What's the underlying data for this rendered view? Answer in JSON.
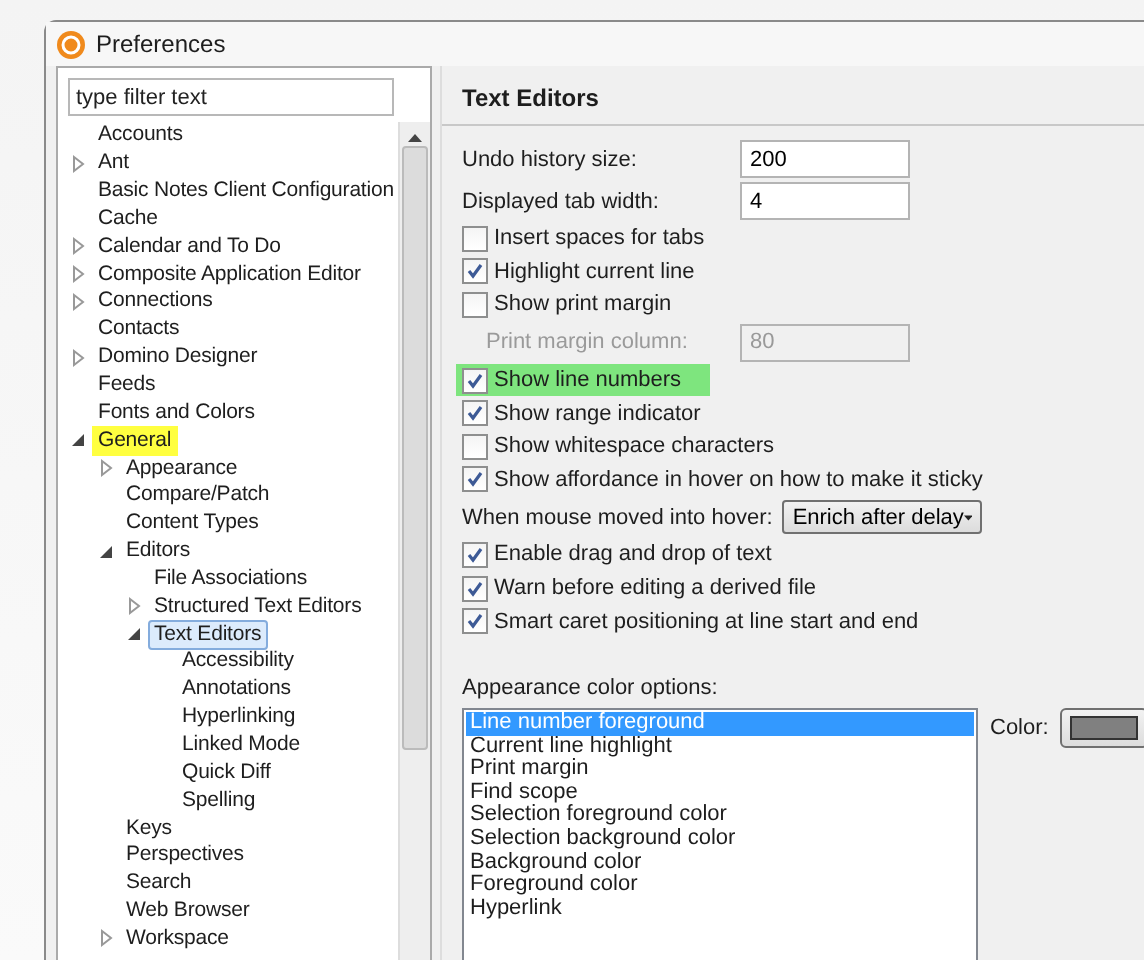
{
  "window": {
    "title": "Preferences"
  },
  "filter": {
    "placeholder": "type filter text"
  },
  "tree": [
    {
      "label": "Accounts",
      "selected": false,
      "highlighted": false
    },
    {
      "label": "Ant",
      "expanded": false,
      "selected": false,
      "highlighted": false
    },
    {
      "label": "Basic Notes Client Configuration",
      "selected": false,
      "highlighted": false
    },
    {
      "label": "Cache",
      "selected": false,
      "highlighted": false
    },
    {
      "label": "Calendar and To Do",
      "expanded": false,
      "selected": false,
      "highlighted": false
    },
    {
      "label": "Composite Application Editor",
      "expanded": false,
      "selected": false,
      "highlighted": false
    },
    {
      "label": "Connections",
      "expanded": false,
      "selected": false,
      "highlighted": false
    },
    {
      "label": "Contacts",
      "selected": false,
      "highlighted": false
    },
    {
      "label": "Domino Designer",
      "expanded": false,
      "selected": false,
      "highlighted": false
    },
    {
      "label": "Feeds",
      "selected": false,
      "highlighted": false
    },
    {
      "label": "Fonts and Colors",
      "selected": false,
      "highlighted": false
    },
    {
      "label": "General",
      "expanded": true,
      "selected": false,
      "highlighted": true,
      "children": [
        {
          "label": "Appearance",
          "expanded": false,
          "selected": false,
          "highlighted": false
        },
        {
          "label": "Compare/Patch",
          "selected": false,
          "highlighted": false
        },
        {
          "label": "Content Types",
          "selected": false,
          "highlighted": false
        },
        {
          "label": "Editors",
          "expanded": true,
          "selected": false,
          "highlighted": false,
          "children": [
            {
              "label": "File Associations",
              "selected": false,
              "highlighted": false
            },
            {
              "label": "Structured Text Editors",
              "expanded": false,
              "selected": false,
              "highlighted": false
            },
            {
              "label": "Text Editors",
              "expanded": true,
              "selected": true,
              "highlighted": false,
              "children": [
                {
                  "label": "Accessibility",
                  "selected": false,
                  "highlighted": false
                },
                {
                  "label": "Annotations",
                  "selected": false,
                  "highlighted": false
                },
                {
                  "label": "Hyperlinking",
                  "selected": false,
                  "highlighted": false
                },
                {
                  "label": "Linked Mode",
                  "selected": false,
                  "highlighted": false
                },
                {
                  "label": "Quick Diff",
                  "selected": false,
                  "highlighted": false
                },
                {
                  "label": "Spelling",
                  "selected": false,
                  "highlighted": false
                }
              ]
            }
          ]
        },
        {
          "label": "Keys",
          "selected": false,
          "highlighted": false
        },
        {
          "label": "Perspectives",
          "selected": false,
          "highlighted": false
        },
        {
          "label": "Search",
          "selected": false,
          "highlighted": false
        },
        {
          "label": "Web Browser",
          "selected": false,
          "highlighted": false
        },
        {
          "label": "Workspace",
          "expanded": false,
          "selected": false,
          "highlighted": false
        }
      ]
    }
  ],
  "page": {
    "title": "Text Editors",
    "settings": [
      {
        "kind": "field",
        "label": "Undo history size:",
        "value": "200",
        "disabled": false
      },
      {
        "kind": "field",
        "label": "Displayed tab width:",
        "value": "4",
        "disabled": false
      },
      {
        "kind": "checkbox",
        "label": "Insert spaces for tabs",
        "checked": false,
        "highlighted": false
      },
      {
        "kind": "checkbox",
        "label": "Highlight current line",
        "checked": true,
        "highlighted": false
      },
      {
        "kind": "checkbox",
        "label": "Show print margin",
        "checked": false,
        "highlighted": false
      },
      {
        "kind": "field",
        "label": "Print margin column:",
        "value": "80",
        "disabled": true
      },
      {
        "kind": "checkbox",
        "label": "Show line numbers",
        "checked": true,
        "highlighted": true
      },
      {
        "kind": "checkbox",
        "label": "Show range indicator",
        "checked": true,
        "highlighted": false
      },
      {
        "kind": "checkbox",
        "label": "Show whitespace characters",
        "checked": false,
        "highlighted": false
      },
      {
        "kind": "checkbox",
        "label": "Show affordance in hover on how to make it sticky",
        "checked": true,
        "highlighted": false
      },
      {
        "kind": "dropdown",
        "label": "When mouse moved into hover:",
        "value": "Enrich after delay"
      },
      {
        "kind": "checkbox",
        "label": "Enable drag and drop of text",
        "checked": true,
        "highlighted": false
      },
      {
        "kind": "checkbox",
        "label": "Warn before editing a derived file",
        "checked": true,
        "highlighted": false
      },
      {
        "kind": "checkbox",
        "label": "Smart caret positioning at line start and end",
        "checked": true,
        "highlighted": false
      }
    ],
    "appearance": {
      "label": "Appearance color options:",
      "color_label": "Color:",
      "color": "#808080",
      "options": [
        {
          "label": "Line number foreground",
          "selected": true
        },
        {
          "label": "Current line highlight",
          "selected": false
        },
        {
          "label": "Print margin",
          "selected": false
        },
        {
          "label": "Find scope",
          "selected": false
        },
        {
          "label": "Selection foreground color",
          "selected": false
        },
        {
          "label": "Selection background color",
          "selected": false
        },
        {
          "label": "Background color",
          "selected": false
        },
        {
          "label": "Foreground color",
          "selected": false
        },
        {
          "label": "Hyperlink",
          "selected": false
        }
      ]
    }
  }
}
